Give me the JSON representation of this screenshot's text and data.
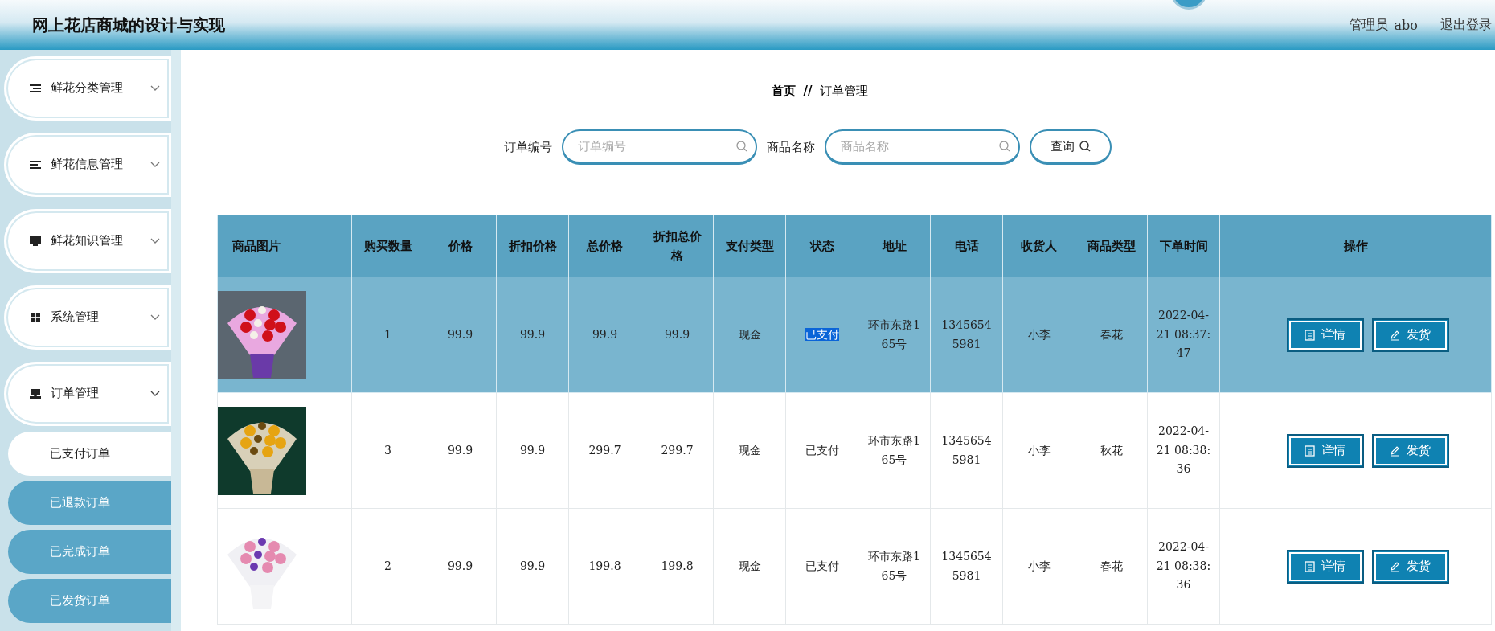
{
  "header": {
    "title": "网上花店商城的设计与实现",
    "user_role": "管理员",
    "user_name": "abo",
    "logout": "退出登录"
  },
  "sidebar": {
    "groups": [
      {
        "label": "鲜花分类管理",
        "expanded": false
      },
      {
        "label": "鲜花信息管理",
        "expanded": false
      },
      {
        "label": "鲜花知识管理",
        "expanded": false
      },
      {
        "label": "系统管理",
        "expanded": false
      },
      {
        "label": "订单管理",
        "expanded": true,
        "children": [
          {
            "label": "已支付订单",
            "selected": true
          },
          {
            "label": "已退款订单",
            "selected": false
          },
          {
            "label": "已完成订单",
            "selected": false
          },
          {
            "label": "已发货订单",
            "selected": false
          }
        ]
      }
    ]
  },
  "breadcrumb": {
    "home": "首页",
    "separator": "//",
    "current": "订单管理"
  },
  "search": {
    "fields": [
      {
        "label": "订单编号",
        "placeholder": "订单编号"
      },
      {
        "label": "商品名称",
        "placeholder": "商品名称"
      }
    ],
    "button": "查询"
  },
  "table": {
    "columns": [
      "商品图片",
      "购买数量",
      "价格",
      "折扣价格",
      "总价格",
      "折扣总价格",
      "支付类型",
      "状态",
      "地址",
      "电话",
      "收货人",
      "商品类型",
      "下单时间",
      "操作"
    ],
    "rows": [
      {
        "selected": true,
        "status_highlighted": true,
        "cells": [
          {
            "kind": "picture"
          },
          "1",
          "99.9",
          "99.9",
          "99.9",
          "99.9",
          "现金",
          "已支付",
          "环市东路165号",
          "13456545981",
          "小李",
          "春花",
          "2022-04-21 08:37:47",
          {
            "kind": "actions",
            "buttons": [
              "详情",
              "发货"
            ]
          }
        ]
      },
      {
        "selected": false,
        "status_highlighted": false,
        "cells": [
          {
            "kind": "picture"
          },
          "3",
          "99.9",
          "99.9",
          "299.7",
          "299.7",
          "现金",
          "已支付",
          "环市东路165号",
          "13456545981",
          "小李",
          "秋花",
          "2022-04-21 08:38:36",
          {
            "kind": "actions",
            "buttons": [
              "详情",
              "发货"
            ]
          }
        ]
      },
      {
        "selected": false,
        "status_highlighted": false,
        "cells": [
          {
            "kind": "picture"
          },
          "2",
          "99.9",
          "99.9",
          "199.8",
          "199.8",
          "现金",
          "已支付",
          "环市东路165号",
          "13456545981",
          "小李",
          "春花",
          "2022-04-21 08:38:36",
          {
            "kind": "actions",
            "buttons": [
              "详情",
              "发货"
            ]
          }
        ]
      }
    ]
  }
}
